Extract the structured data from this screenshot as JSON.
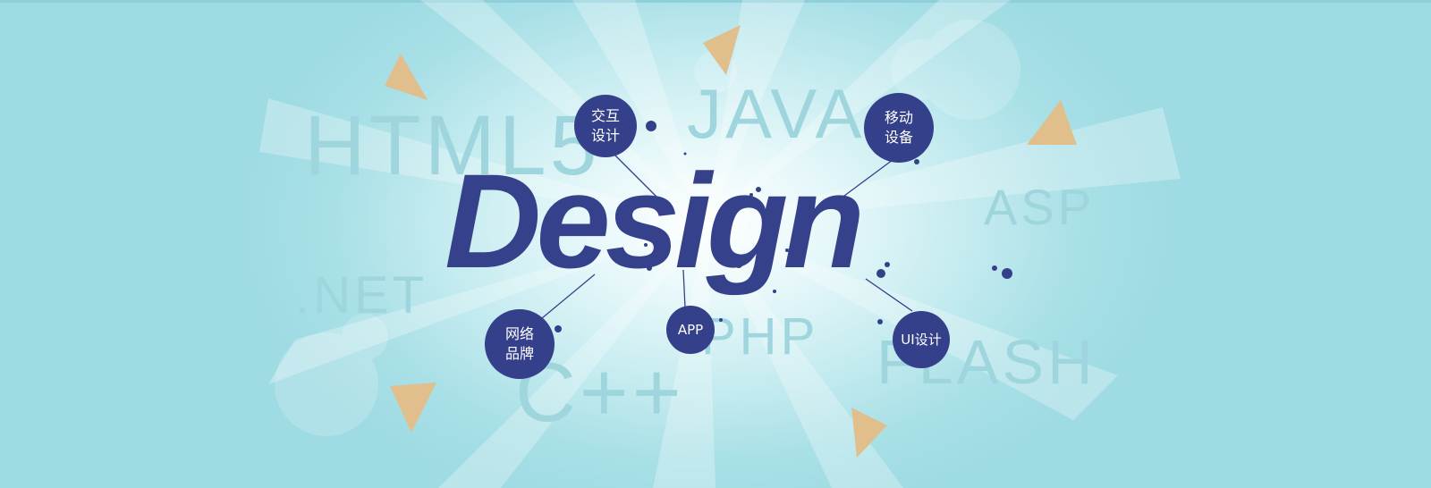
{
  "hero": {
    "logo_word": "Design",
    "primary_color": "#35418a",
    "accent_color": "#e2bf8c",
    "background_color": "#a9e0e7",
    "background_languages": [
      "HTML5",
      "JAVA",
      "ASP",
      ".NET",
      "PHP",
      "C++",
      "FLASH"
    ],
    "nodes": [
      {
        "id": "interaction",
        "label": "交互\n设计"
      },
      {
        "id": "mobile",
        "label": "移动\n设备"
      },
      {
        "id": "brand",
        "label": "网络\n品牌"
      },
      {
        "id": "app",
        "label": "APP"
      },
      {
        "id": "ui",
        "label": "UI设计"
      }
    ]
  }
}
